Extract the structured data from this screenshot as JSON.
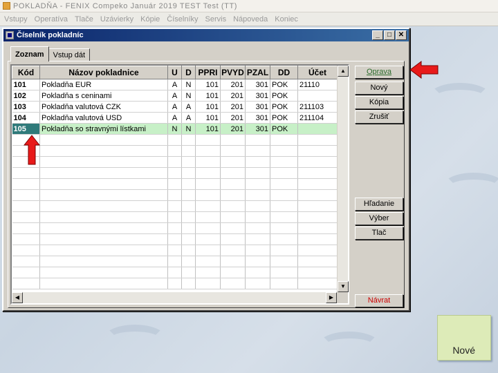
{
  "app": {
    "title": "POKLADŇA - FENIX Compeko  Január 2019  TEST Test  (TT)"
  },
  "menu": [
    "Vstupy",
    "Operatíva",
    "Tlače",
    "Uzávierky",
    "Kópie",
    "Číselníky",
    "Servis",
    "Nápoveda",
    "Koniec"
  ],
  "window": {
    "title": "Číselník pokladníc"
  },
  "tabs": [
    {
      "label": "Zoznam",
      "active": true
    },
    {
      "label": "Vstup dát",
      "active": false
    }
  ],
  "table": {
    "columns": [
      "Kód",
      "Názov pokladnice",
      "U",
      "D",
      "PPRI",
      "PVYD",
      "PZAL",
      "DD",
      "Účet"
    ],
    "rows": [
      [
        "101",
        "Pokladňa EUR",
        "A",
        "N",
        "101",
        "201",
        "301",
        "POK",
        "21110"
      ],
      [
        "102",
        "Pokladňa s ceninami",
        "A",
        "N",
        "101",
        "201",
        "301",
        "POK",
        ""
      ],
      [
        "103",
        "Pokladňa valutová CZK",
        "A",
        "A",
        "101",
        "201",
        "301",
        "POK",
        "211103"
      ],
      [
        "104",
        "Pokladňa valutová USD",
        "A",
        "A",
        "101",
        "201",
        "301",
        "POK",
        "211104"
      ],
      [
        "105",
        "Pokladňa so stravnými lístkami",
        "N",
        "N",
        "101",
        "201",
        "301",
        "POK",
        ""
      ]
    ],
    "selected_row": 4
  },
  "buttons": {
    "oprava": "Oprava",
    "novy": "Nový",
    "kopia": "Kópia",
    "zrusit": "Zrušiť",
    "hladanie": "Hľadanie",
    "vyber": "Výber",
    "tlac": "Tlač",
    "navrat": "Návrat"
  },
  "note": {
    "label": "Nové"
  },
  "colors": {
    "accent_arrow": "#e81a1a",
    "title_bar": "#0a246a",
    "selected_row": "#c7f0c7",
    "return_text": "#cc0000"
  }
}
